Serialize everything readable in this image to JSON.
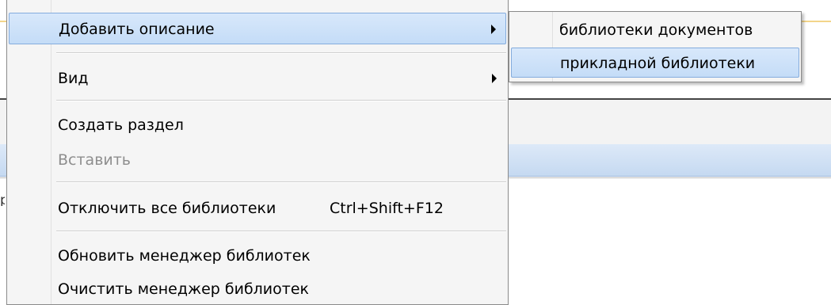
{
  "background": {
    "left_fragment": "р"
  },
  "context_menu": {
    "items": [
      {
        "label": "Добавить описание",
        "has_submenu": true,
        "highlighted": true,
        "enabled": true
      },
      {
        "label": "Вид",
        "has_submenu": true,
        "highlighted": false,
        "enabled": true
      },
      {
        "label": "Создать раздел",
        "enabled": true
      },
      {
        "label": "Вставить",
        "enabled": false
      },
      {
        "label": "Отключить все библиотеки",
        "shortcut": "Ctrl+Shift+F12",
        "enabled": true
      },
      {
        "label": "Обновить менеджер библиотек",
        "enabled": true
      },
      {
        "label": "Очистить менеджер библиотек",
        "enabled": true
      }
    ]
  },
  "submenu": {
    "items": [
      {
        "label": "библиотеки документов",
        "highlighted": false
      },
      {
        "label": "прикладной библиотеки",
        "highlighted": true
      }
    ]
  },
  "colors": {
    "highlight_fill": "#c4dcf7",
    "highlight_border": "#84acdd",
    "menu_background": "#f5f5f5",
    "disabled_text": "#8e8e8e"
  }
}
